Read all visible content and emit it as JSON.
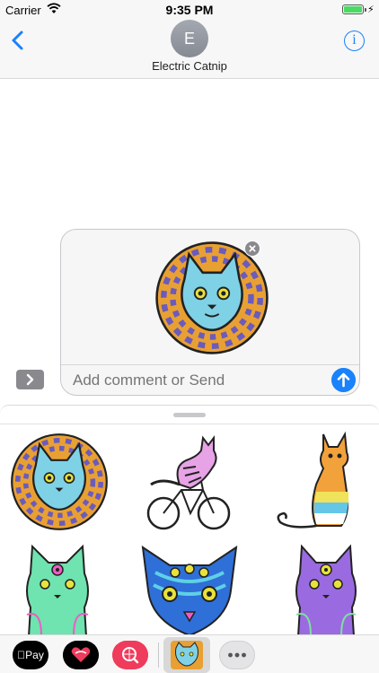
{
  "status_bar": {
    "carrier": "Carrier",
    "time": "9:35 PM",
    "battery_level": 1.0
  },
  "nav": {
    "avatar_initial": "E",
    "contact_name": "Electric Catnip",
    "info_label": "i",
    "back_icon": "chevron-left-icon"
  },
  "compose": {
    "placeholder": "Add comment or Send",
    "send_icon": "arrow-up-icon",
    "expand_icon": "chevron-right-icon"
  },
  "stickers": [
    {
      "name": "blue-cat-hypnotic-sticker"
    },
    {
      "name": "pink-cat-bicycle-sticker"
    },
    {
      "name": "rainbow-sitting-cat-sticker"
    },
    {
      "name": "green-three-eyed-cat-sticker"
    },
    {
      "name": "blue-four-eyed-cat-sticker"
    },
    {
      "name": "purple-three-eyed-cat-sticker"
    }
  ],
  "app_strip": {
    "apple_pay_label": "Pay",
    "apps": [
      "apple-pay",
      "digital-touch",
      "image-search",
      "electric-catnip",
      "more"
    ]
  },
  "colors": {
    "accent": "#1a82fb",
    "battery": "#4cd964",
    "search_app": "#ef3b5c"
  }
}
